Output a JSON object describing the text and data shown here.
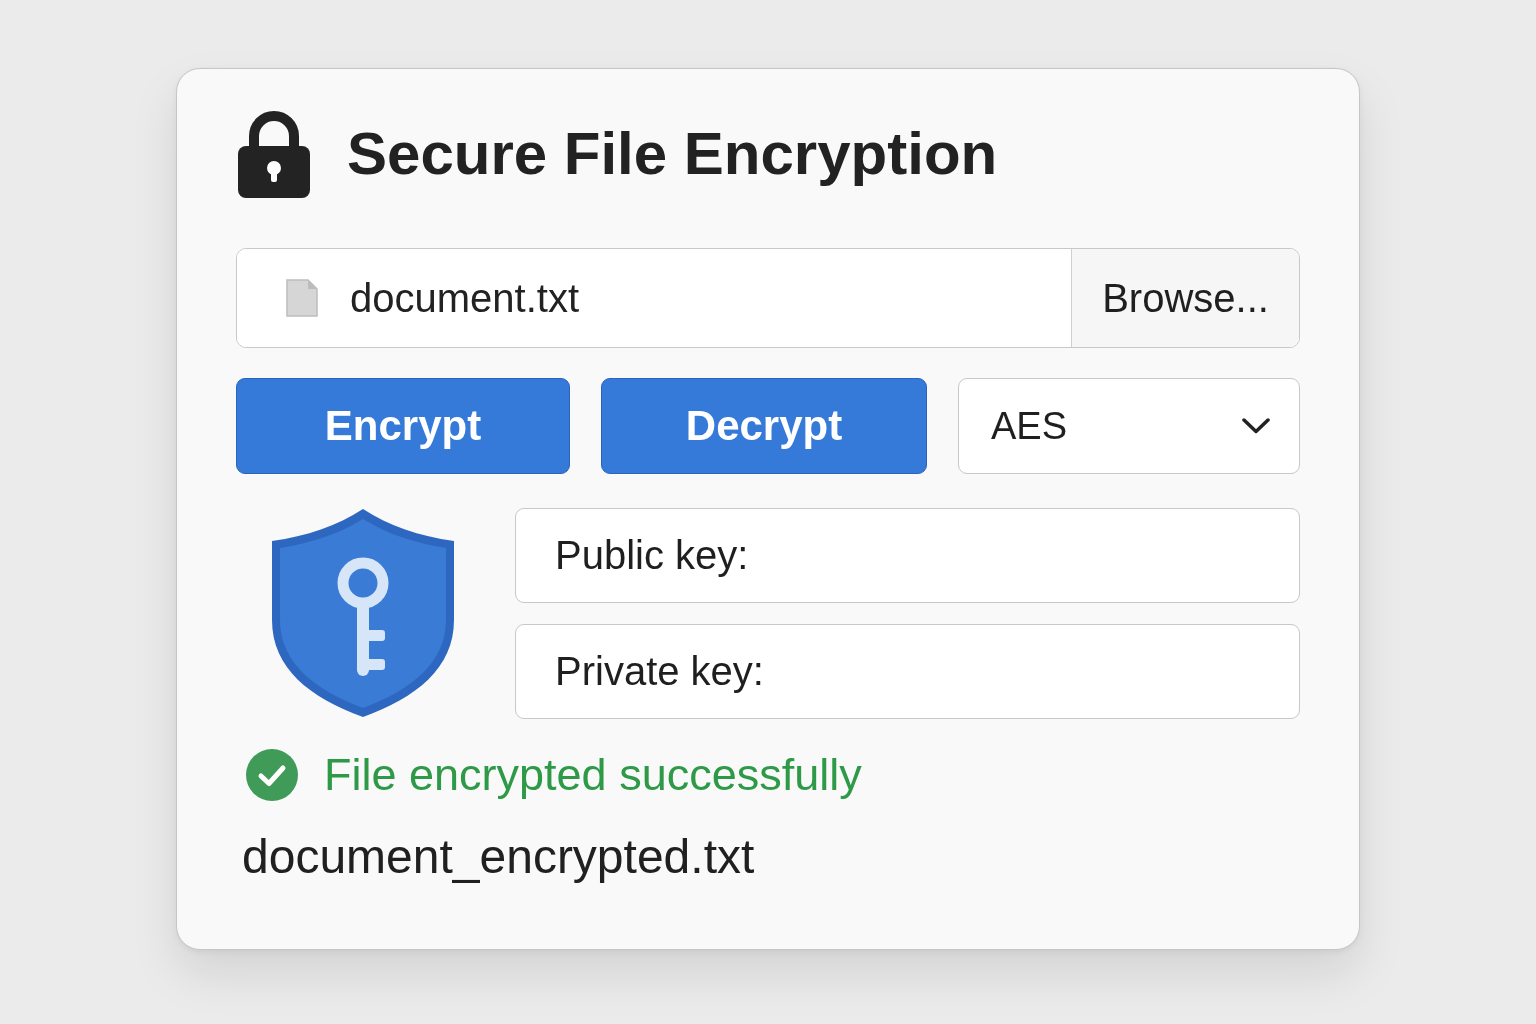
{
  "window": {
    "title": "Secure File Encryption"
  },
  "file_picker": {
    "value": "document.txt",
    "button": "Browse..."
  },
  "actions": [
    {
      "label": "Encrypt"
    },
    {
      "label": "Decrypt"
    }
  ],
  "algorithm": {
    "value": "AES"
  },
  "key_fields": [
    {
      "label": "Public key:"
    },
    {
      "label": "Private key:"
    }
  ],
  "status": {
    "kind": "success",
    "message": "File encrypted successfully"
  },
  "output_file": {
    "name": "document_encrypted.txt"
  }
}
